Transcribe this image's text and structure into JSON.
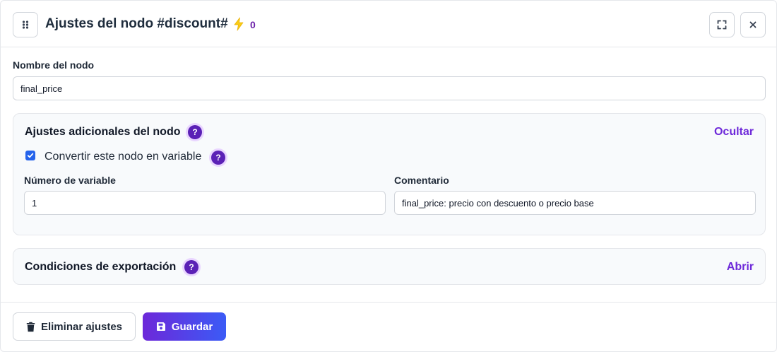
{
  "header": {
    "title": "Ajustes del nodo #discount#",
    "bolt_count": "0"
  },
  "node_name": {
    "label": "Nombre del nodo",
    "value": "final_price"
  },
  "additional_settings": {
    "title": "Ajustes adicionales del nodo",
    "help_symbol": "?",
    "toggle_label": "Ocultar",
    "convert_checkbox": {
      "label": "Convertir este nodo en variable",
      "checked": true
    },
    "variable_number": {
      "label": "Número de variable",
      "value": "1"
    },
    "comment": {
      "label": "Comentario",
      "value": "final_price: precio con descuento o precio base"
    }
  },
  "export_conditions": {
    "title": "Condiciones de exportación",
    "help_symbol": "?",
    "toggle_label": "Abrir"
  },
  "footer": {
    "delete_label": "Eliminar ajustes",
    "save_label": "Guardar"
  },
  "colors": {
    "accent": "#6d28d9",
    "help_badge": "#5b21b6",
    "save_gradient_end": "#3b5bf6",
    "checkbox": "#2563eb"
  },
  "icons": {
    "drag": "drag-handle-icon",
    "bolt": "lightning-bolt-icon",
    "expand": "expand-icon",
    "close": "close-icon",
    "trash": "trash-icon",
    "save": "floppy-disk-icon"
  }
}
